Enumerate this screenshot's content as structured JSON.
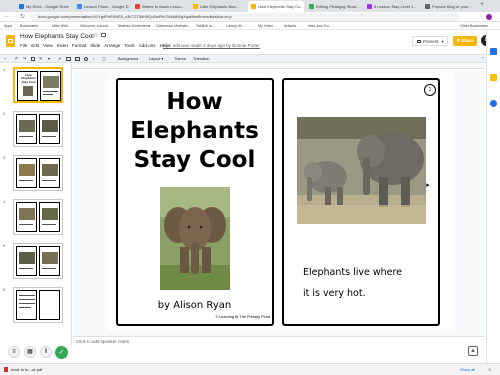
{
  "browser": {
    "tabs": [
      {
        "label": "My Drive - Google Drive",
        "color": "#1a73e8"
      },
      {
        "label": "Lesson Plans - Google D...",
        "color": "#4285f4"
      },
      {
        "label": "Where to teach Lesso...",
        "color": "#ea4335"
      },
      {
        "label": "Little Elephants Bea...",
        "color": "#fbbc04"
      },
      {
        "label": "How Elephants Stay Co...",
        "color": "#f6b704"
      },
      {
        "label": "Editing Pedagog Stuck ...",
        "color": "#34a853"
      },
      {
        "label": "5 Lesson Stay Level 1...",
        "color": "#9334e6"
      },
      {
        "label": "Popular Blog of your ...",
        "color": "#5f6368"
      }
    ],
    "url": "docs.google.com/presentation/d/1Yg4PhS9NR3_s3K72T5kH8Qd0wPfb7Wk8dWgXqaMbzBnn/edit#slide=id.p",
    "bookmarks": [
      "Apps",
      "Bookmarks",
      "Mike Wild...",
      "Welcome, educat...",
      "Mathies Worksheets",
      "Classroom Medialin...",
      "TabBell ro...",
      "Library lib...",
      "My Video",
      "Artisela",
      "Inter-Ann Gu..."
    ],
    "other_bookmarks": "Other Bookmarks"
  },
  "header": {
    "title": "How Elephants Stay Cool",
    "last_edit": "Last edit was made 3 days ago by Bonnie Porter",
    "menus": [
      "File",
      "Edit",
      "View",
      "Insert",
      "Format",
      "Slide",
      "Arrange",
      "Tools",
      "Add-ons",
      "Help"
    ],
    "present_label": "Present",
    "share_label": "Share",
    "avatar_letter": "B"
  },
  "toolbar": {
    "background_label": "Background",
    "layout_label": "Layout",
    "theme_label": "Theme",
    "transition_label": "Transition"
  },
  "filmstrip": {
    "numbers": [
      "1",
      "2",
      "3",
      "4",
      "5",
      "6"
    ]
  },
  "slide": {
    "title_lines": [
      "How",
      "Elephants",
      "Stay Cool"
    ],
    "author": "by Alison Ryan",
    "credit": "© Learning At The Primary Pond",
    "page_number": "1",
    "body_lines": [
      "Elephants live where",
      "it is very hot."
    ]
  },
  "notes": {
    "placeholder": "Click to add speaker notes"
  },
  "status": {
    "download_file": "book in fo...ck.pdf",
    "show_all": "Show all"
  },
  "colors": {
    "share_button": "#f6b704",
    "accent": "#1a73e8",
    "zoom_button": "#34a853"
  }
}
